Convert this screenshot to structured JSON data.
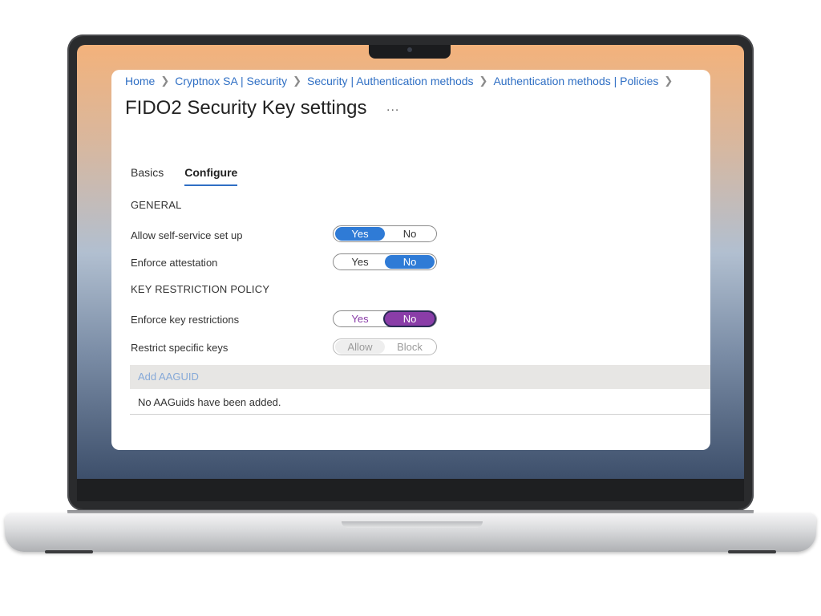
{
  "breadcrumb": [
    "Home",
    "Cryptnox SA | Security",
    "Security | Authentication methods",
    "Authentication methods | Policies"
  ],
  "page": {
    "title": "FIDO2 Security Key settings",
    "more_label": "..."
  },
  "tabs": [
    {
      "label": "Basics",
      "active": false
    },
    {
      "label": "Configure",
      "active": true
    }
  ],
  "general": {
    "heading": "GENERAL",
    "self_service": {
      "label": "Allow self-service set up",
      "yes": "Yes",
      "no": "No",
      "value": "Yes"
    },
    "attestation": {
      "label": "Enforce attestation",
      "yes": "Yes",
      "no": "No",
      "value": "No"
    }
  },
  "key_restriction": {
    "heading": "KEY RESTRICTION POLICY",
    "enforce": {
      "label": "Enforce key restrictions",
      "yes": "Yes",
      "no": "No",
      "value": "No"
    },
    "restrict": {
      "label": "Restrict specific keys",
      "allow": "Allow",
      "block": "Block",
      "value": "Allow",
      "disabled": true
    }
  },
  "aaguid": {
    "add_label": "Add AAGUID",
    "empty_message": "No AAGuids have been added."
  },
  "colors": {
    "accent": "#2f7bd6",
    "link": "#2f6fc4",
    "highlight": "#8a3da8"
  }
}
